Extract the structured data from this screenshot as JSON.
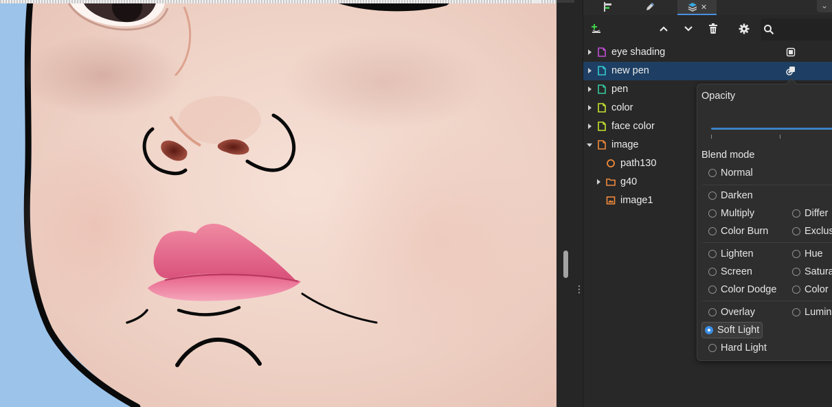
{
  "panel": {
    "tabs": [
      {
        "name": "align-tab",
        "icon": "align-icon"
      },
      {
        "name": "pen-tab",
        "icon": "pen-icon"
      },
      {
        "name": "layers-tab",
        "icon": "layers-icon",
        "active": true
      }
    ],
    "toolbar": {
      "buttons": [
        "add-layer-icon",
        "raise-icon",
        "lower-icon",
        "delete-icon",
        "settings-icon",
        "search-icon"
      ]
    },
    "layers": [
      {
        "label": "eye shading",
        "type": "layer",
        "color": "#c04fd6",
        "expandable": true,
        "indent": 0,
        "action_icon": "mask-icon"
      },
      {
        "label": "new pen",
        "type": "layer",
        "color": "#35c9d0",
        "expandable": true,
        "indent": 0,
        "selected": true,
        "action_icon": "blend-icon"
      },
      {
        "label": "pen",
        "type": "layer",
        "color": "#35c9a0",
        "expandable": true,
        "indent": 0
      },
      {
        "label": "color",
        "type": "layer",
        "color": "#c8e62e",
        "expandable": true,
        "indent": 0
      },
      {
        "label": "face color",
        "type": "layer",
        "color": "#c8e62e",
        "expandable": true,
        "indent": 0
      },
      {
        "label": "image",
        "type": "layer",
        "color": "#f08a3c",
        "expandable": true,
        "expanded": true,
        "indent": 0
      },
      {
        "label": "path130",
        "type": "path",
        "color": "#f08a3c",
        "expandable": false,
        "indent": 1
      },
      {
        "label": "g40",
        "type": "group",
        "color": "#f08a3c",
        "expandable": true,
        "indent": 1
      },
      {
        "label": "image1",
        "type": "image",
        "color": "#f08a3c",
        "expandable": false,
        "indent": 1
      }
    ]
  },
  "popover": {
    "opacity_label": "Opacity",
    "blend_label": "Blend mode",
    "modes": {
      "normal": "Normal",
      "darken": "Darken",
      "multiply": "Multiply",
      "color_burn": "Color Burn",
      "difference": "Differ",
      "exclusion": "Exclus",
      "lighten": "Lighten",
      "screen": "Screen",
      "color_dodge": "Color Dodge",
      "hue": "Hue",
      "saturation": "Satura",
      "color": "Color",
      "overlay": "Overlay",
      "luminosity": "Lumin",
      "soft_light": "Soft Light",
      "hard_light": "Hard Light"
    },
    "selected_mode": "Soft Light",
    "accent_color": "#3a8ee6"
  },
  "canvas": {
    "background_color": "#9cc3ea"
  }
}
